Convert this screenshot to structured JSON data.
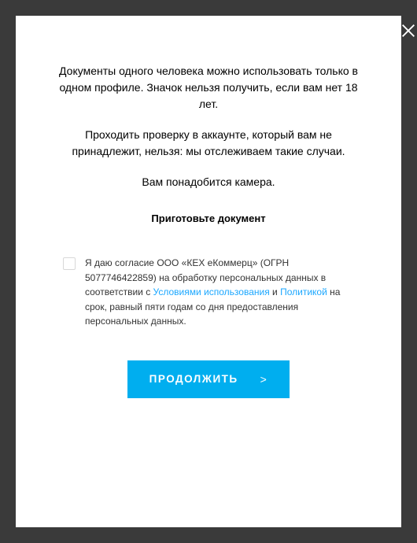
{
  "modal": {
    "paragraphs": [
      "Документы одного человека можно использовать только в одном профиле. Значок нельзя получить, если вам нет 18 лет.",
      "Проходить проверку в аккаунте, который вам не принадлежит, нельзя: мы отслеживаем такие случаи.",
      "Вам понадобится камера."
    ],
    "prepare_heading": "Приготовьте документ",
    "consent": {
      "text_before_link1": "Я даю согласие ООО «КЕХ еКоммерц» (ОГРН 5077746422859) на обработку персональных данных в соответствии с ",
      "link1": "Условиями использования",
      "text_between": " и ",
      "link2": "Политикой",
      "text_after": " на срок, равный пяти годам со дня предоставления персональных данных."
    },
    "continue_button": "ПРОДОЛЖИТЬ",
    "continue_arrow": ">"
  }
}
